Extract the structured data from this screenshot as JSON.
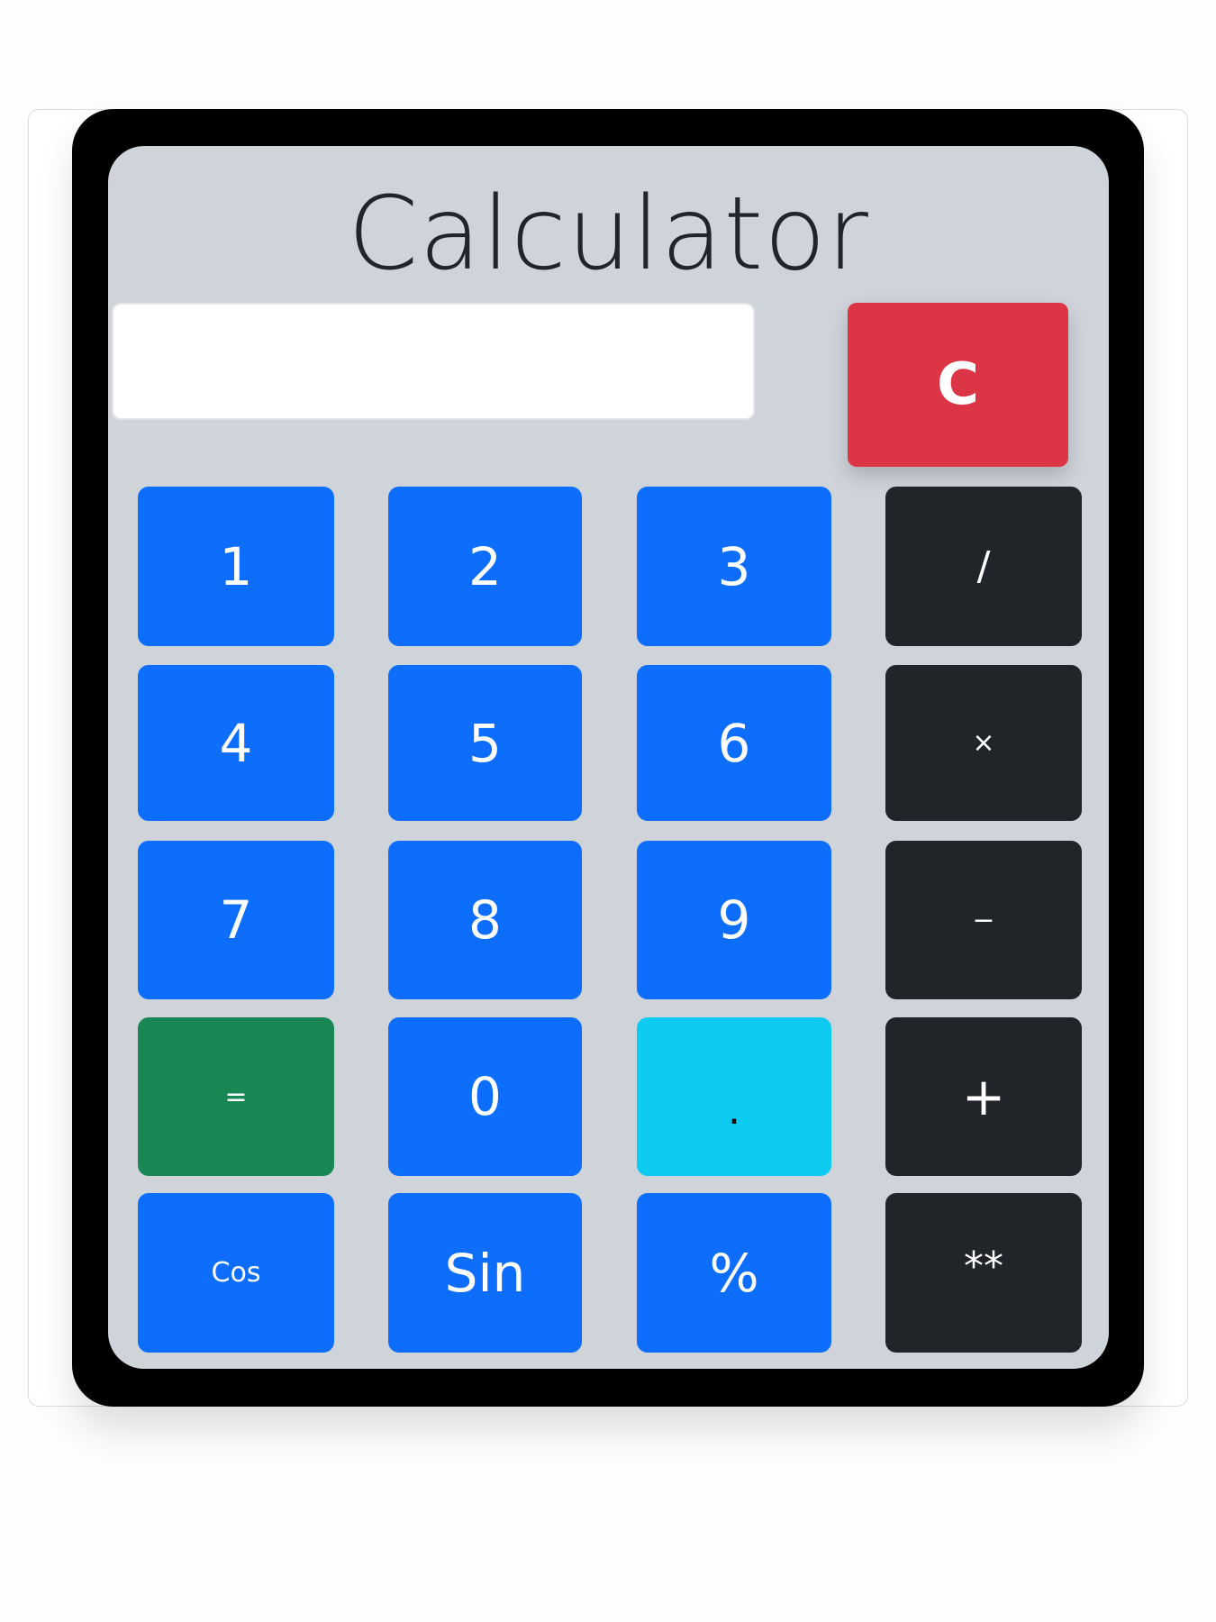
{
  "calculator": {
    "title": "Calculator",
    "display_value": "",
    "clear_label": "C",
    "keys": {
      "one": "1",
      "two": "2",
      "three": "3",
      "divide": "/",
      "four": "4",
      "five": "5",
      "six": "6",
      "multiply": "×",
      "seven": "7",
      "eight": "8",
      "nine": "9",
      "subtract": "−",
      "equals": "=",
      "zero": "0",
      "decimal": ".",
      "add": "+",
      "cos": "Cos",
      "sin": "Sin",
      "percent": "%",
      "power": "**"
    }
  },
  "colors": {
    "primary": "#0d6efd",
    "dark": "#212529",
    "success": "#198754",
    "info": "#0dcaf0",
    "danger": "#dc3545",
    "panel": "#cfd4da"
  }
}
